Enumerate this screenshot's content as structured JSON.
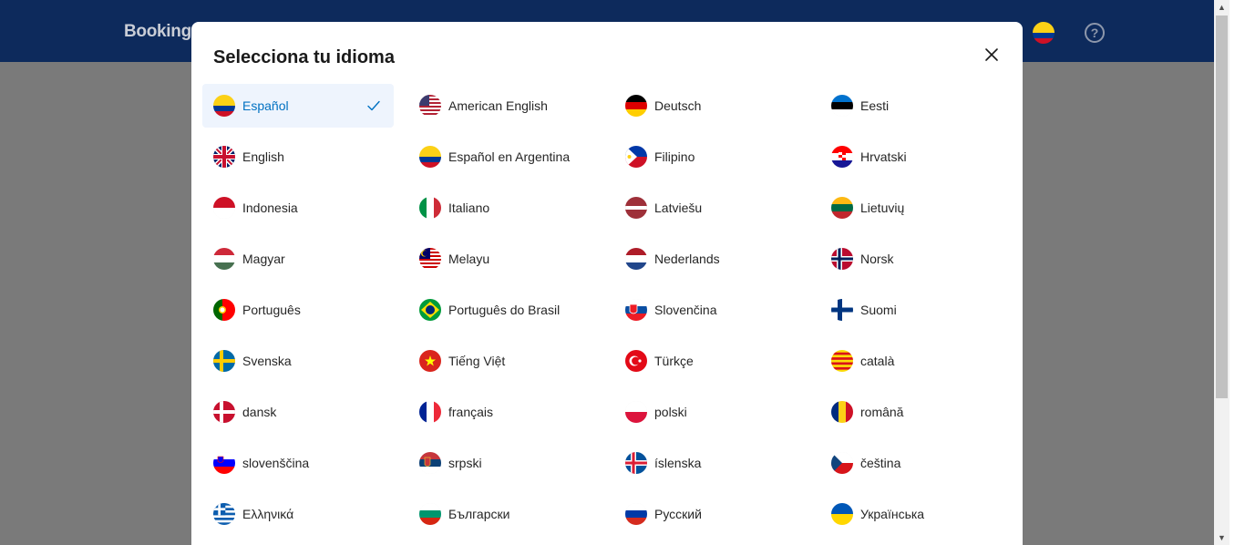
{
  "background": {
    "logo": "Booking.",
    "help_icon": "question-circle-icon",
    "help_glyph": "?"
  },
  "modal": {
    "title": "Selecciona tu idioma",
    "close_icon": "close-icon",
    "selected_icon": "checkmark-icon",
    "languages": [
      {
        "label": "Español",
        "flag": "co",
        "selected": true
      },
      {
        "label": "American English",
        "flag": "us"
      },
      {
        "label": "Deutsch",
        "flag": "de"
      },
      {
        "label": "Eesti",
        "flag": "ee"
      },
      {
        "label": "English",
        "flag": "gb"
      },
      {
        "label": "Español en Argentina",
        "flag": "co"
      },
      {
        "label": "Filipino",
        "flag": "ph"
      },
      {
        "label": "Hrvatski",
        "flag": "hr"
      },
      {
        "label": "Indonesia",
        "flag": "id"
      },
      {
        "label": "Italiano",
        "flag": "it"
      },
      {
        "label": "Latviešu",
        "flag": "lv"
      },
      {
        "label": "Lietuvių",
        "flag": "lt"
      },
      {
        "label": "Magyar",
        "flag": "hu"
      },
      {
        "label": "Melayu",
        "flag": "my"
      },
      {
        "label": "Nederlands",
        "flag": "nl"
      },
      {
        "label": "Norsk",
        "flag": "no"
      },
      {
        "label": "Português",
        "flag": "pt"
      },
      {
        "label": "Português do Brasil",
        "flag": "br"
      },
      {
        "label": "Slovenčina",
        "flag": "sk"
      },
      {
        "label": "Suomi",
        "flag": "fi"
      },
      {
        "label": "Svenska",
        "flag": "se"
      },
      {
        "label": "Tiếng Việt",
        "flag": "vn"
      },
      {
        "label": "Türkçe",
        "flag": "tr"
      },
      {
        "label": "català",
        "flag": "ca"
      },
      {
        "label": "dansk",
        "flag": "dk"
      },
      {
        "label": "français",
        "flag": "fr"
      },
      {
        "label": "polski",
        "flag": "pl"
      },
      {
        "label": "română",
        "flag": "ro"
      },
      {
        "label": "slovenščina",
        "flag": "si"
      },
      {
        "label": "srpski",
        "flag": "rs"
      },
      {
        "label": "íslenska",
        "flag": "is"
      },
      {
        "label": "čeština",
        "flag": "cz"
      },
      {
        "label": "Ελληνικά",
        "flag": "gr"
      },
      {
        "label": "Български",
        "flag": "bg"
      },
      {
        "label": "Русский",
        "flag": "ru"
      },
      {
        "label": "Українська",
        "flag": "ua"
      }
    ]
  },
  "colors": {
    "header": "#0d2a5c",
    "overlay": "#7a7a7a",
    "selected_bg": "#eef4fd",
    "selected_text": "#0071c2"
  }
}
